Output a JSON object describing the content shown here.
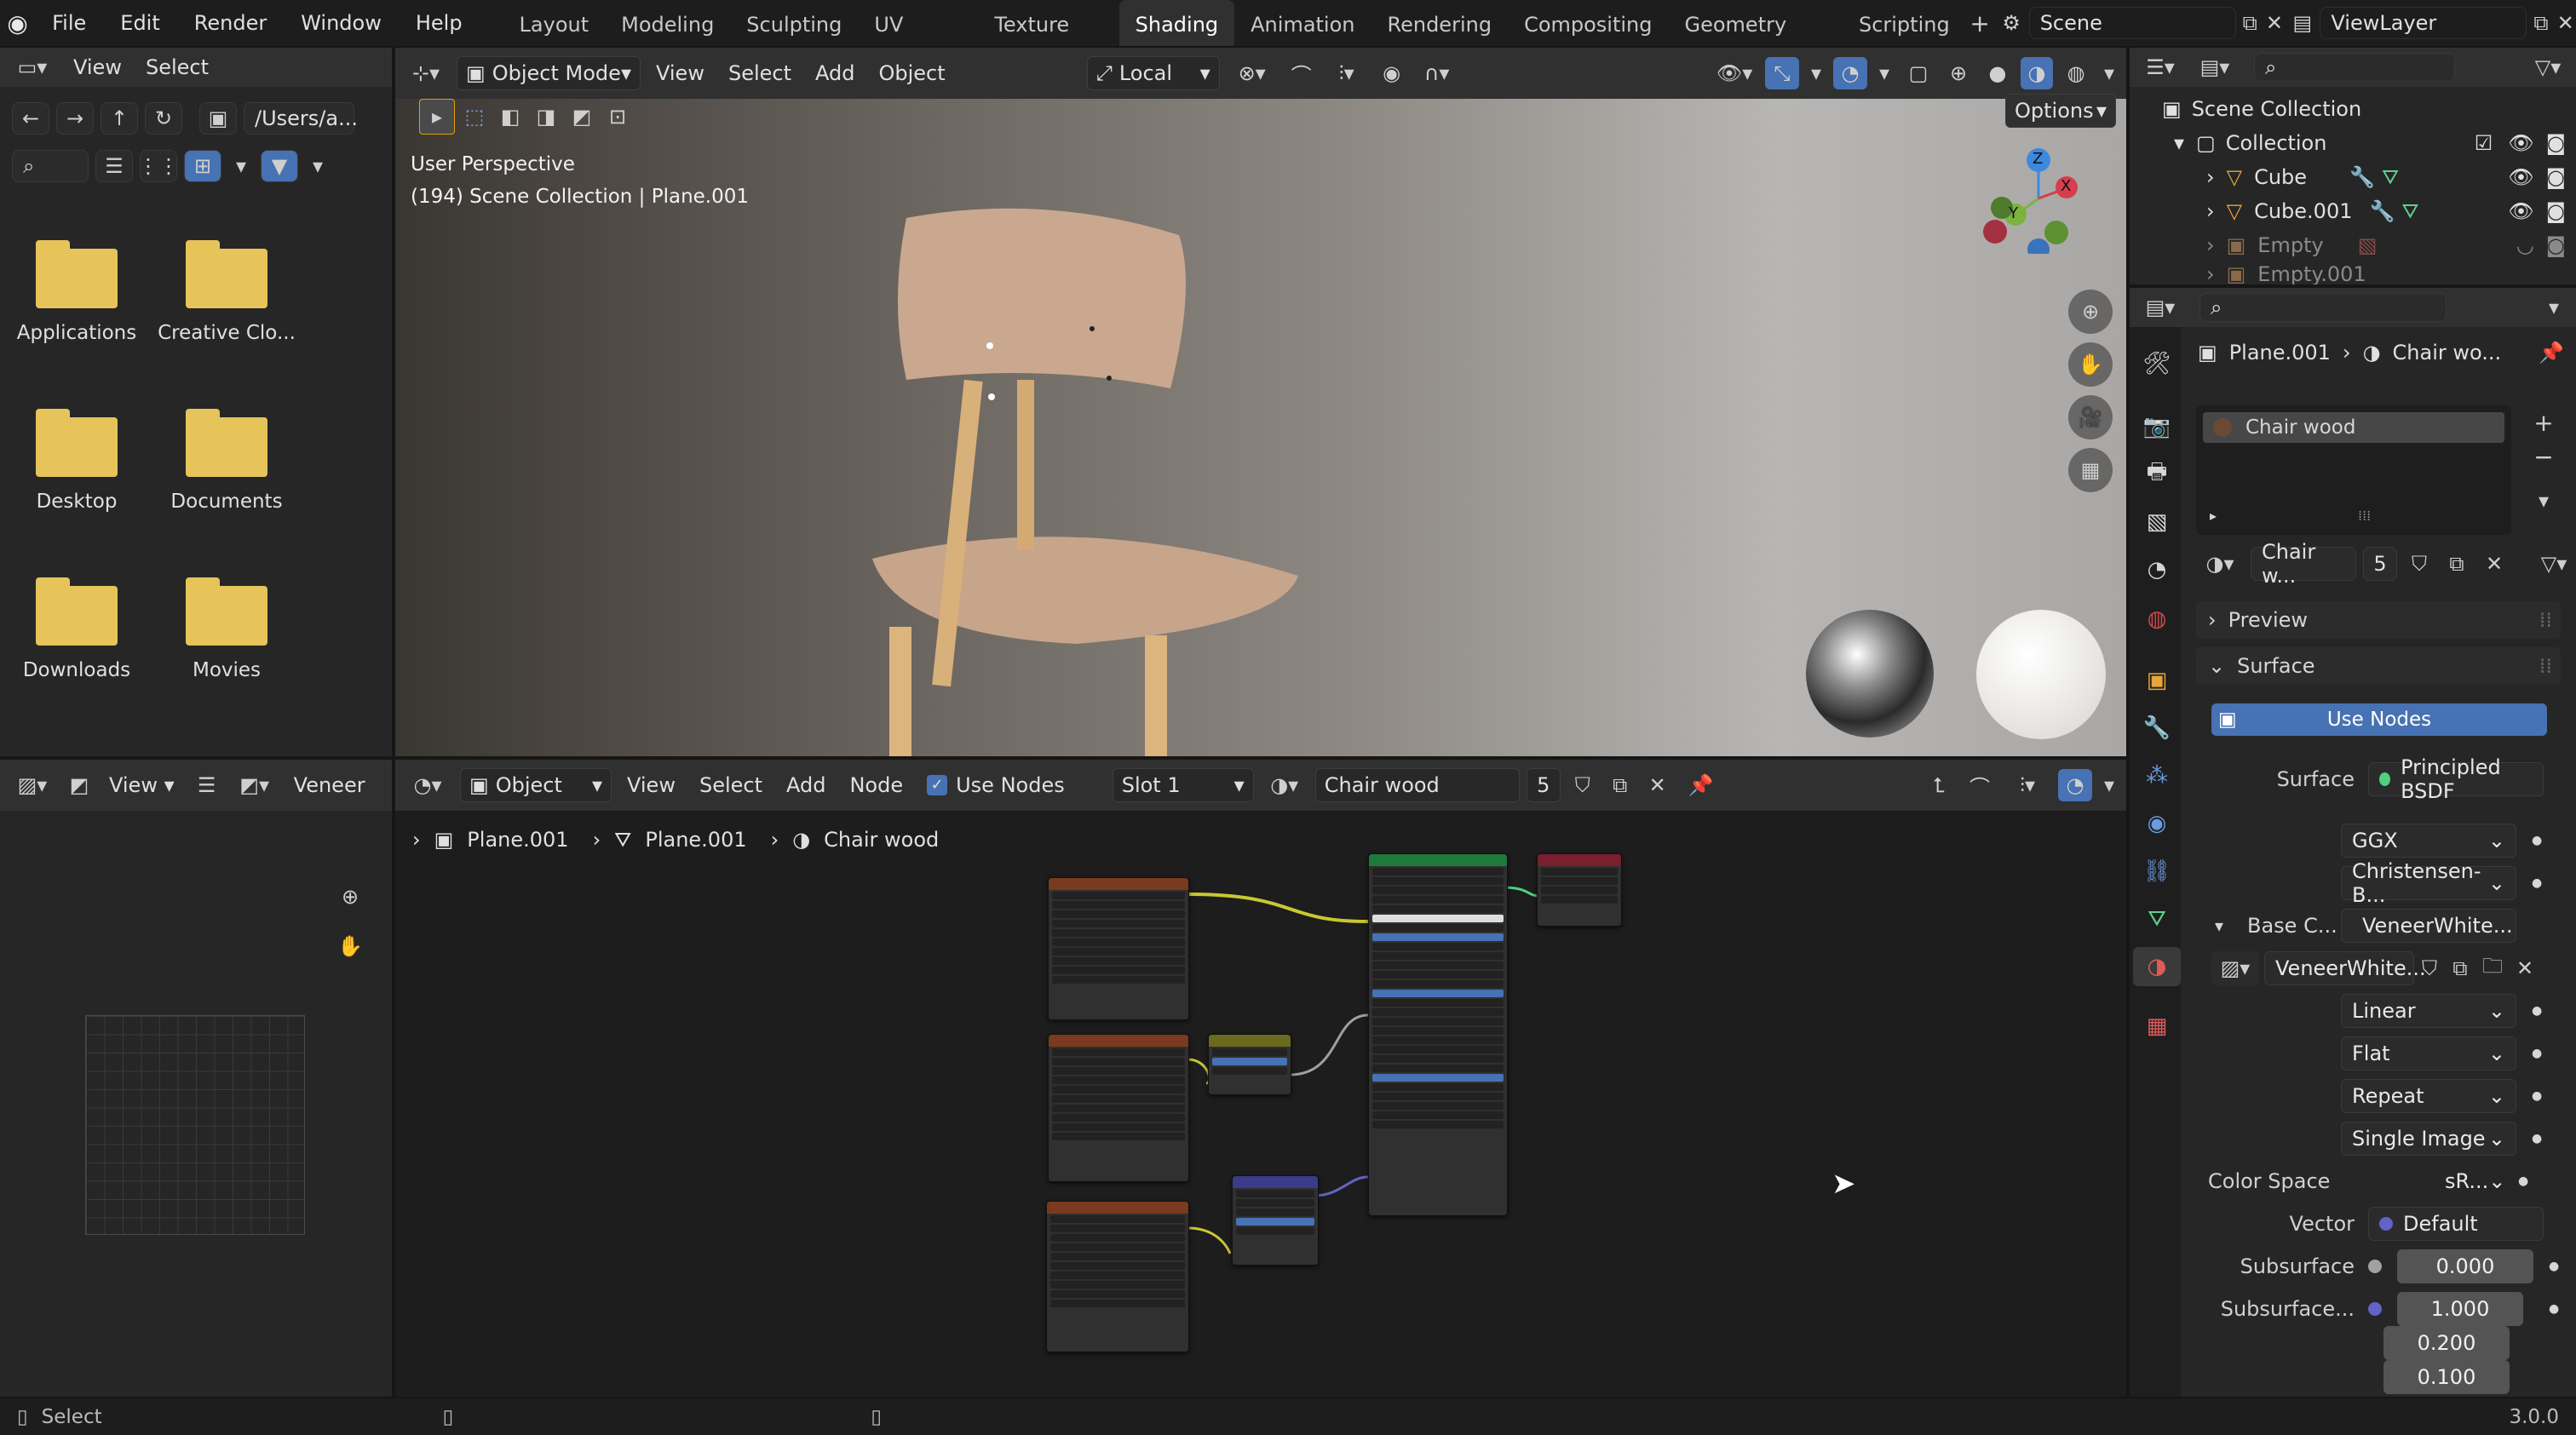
{
  "topbar": {
    "menus": [
      "File",
      "Edit",
      "Render",
      "Window",
      "Help"
    ],
    "workspaces": [
      "Layout",
      "Modeling",
      "Sculpting",
      "UV Editing",
      "Texture Paint",
      "Shading",
      "Animation",
      "Rendering",
      "Compositing",
      "Geometry Nodes",
      "Scripting"
    ],
    "active_workspace": "Shading",
    "scene": "Scene",
    "view_layer": "ViewLayer"
  },
  "filebrowser": {
    "menus": [
      "View",
      "Select"
    ],
    "path": "/Users/a...",
    "items": [
      {
        "label": "Applications"
      },
      {
        "label": "Creative Clo..."
      },
      {
        "label": "Desktop"
      },
      {
        "label": "Documents"
      },
      {
        "label": "Downloads"
      },
      {
        "label": "Movies"
      }
    ]
  },
  "viewport": {
    "mode": "Object Mode",
    "menus": [
      "View",
      "Select",
      "Add",
      "Object"
    ],
    "transform": "Local",
    "options": "Options",
    "overlay_line1": "User Perspective",
    "overlay_line2": "(194) Scene Collection | Plane.001",
    "gizmo": {
      "z": "Z",
      "y": "Y",
      "x": "X"
    }
  },
  "image_editor": {
    "view": "View",
    "image_name": "Veneer"
  },
  "node_editor": {
    "object_mode": "Object",
    "menus": [
      "View",
      "Select",
      "Add",
      "Node"
    ],
    "use_nodes": "Use Nodes",
    "slot": "Slot 1",
    "material": "Chair wood",
    "users": "5",
    "breadcrumb": [
      "Plane.001",
      "Plane.001",
      "Chair wood"
    ]
  },
  "outliner": {
    "root": "Scene Collection",
    "collection": "Collection",
    "items": [
      "Cube",
      "Cube.001",
      "Empty",
      "Empty.001"
    ]
  },
  "properties": {
    "breadcrumb_obj": "Plane.001",
    "breadcrumb_mat": "Chair wo...",
    "slot_material": "Chair wood",
    "material_name": "Chair w...",
    "material_users": "5",
    "panel_preview": "Preview",
    "panel_surface": "Surface",
    "use_nodes": "Use Nodes",
    "surface_label": "Surface",
    "surface_value": "Principled BSDF",
    "distribution": "GGX",
    "subsurface_method": "Christensen-B...",
    "base_color_label": "Base C...",
    "base_color_value": "VeneerWhite...",
    "image_name": "VeneerWhite...",
    "interpolation": "Linear",
    "projection": "Flat",
    "extension": "Repeat",
    "source": "Single Image",
    "color_space_label": "Color Space",
    "color_space_value": "sR...",
    "vector_label": "Vector",
    "vector_value": "Default",
    "subsurface_label": "Subsurface",
    "subsurface_value": "0.000",
    "subsurface_radius_label": "Subsurface...",
    "subsurface_radius": [
      "1.000",
      "0.200",
      "0.100"
    ]
  },
  "statusbar": {
    "left": "Select",
    "version": "3.0.0"
  },
  "colors": {
    "accent": "#4772b3",
    "panel": "#303030",
    "folder": "#e6c45a"
  }
}
